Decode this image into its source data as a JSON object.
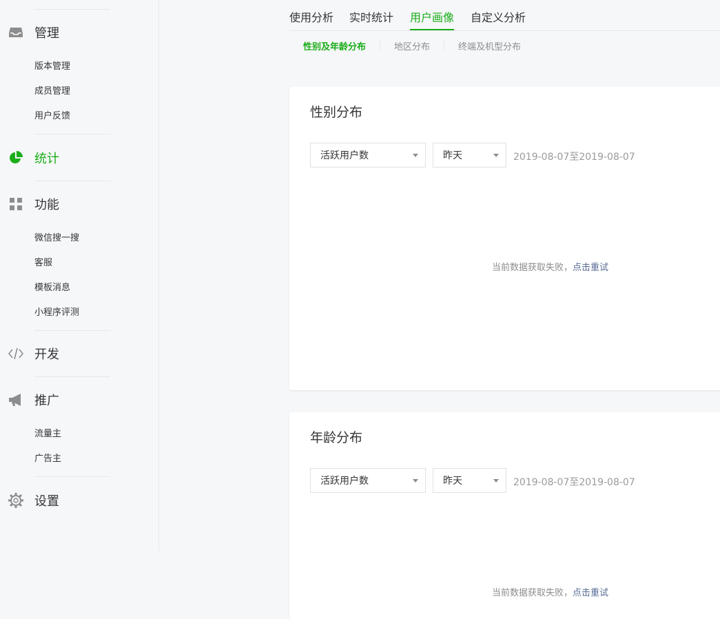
{
  "sidebar": {
    "groups": [
      {
        "label": "管理",
        "icon": "inbox-icon",
        "items": [
          "版本管理",
          "成员管理",
          "用户反馈"
        ]
      },
      {
        "label": "统计",
        "icon": "pie-chart-icon",
        "active": true,
        "items": []
      },
      {
        "label": "功能",
        "icon": "grid-icon",
        "items": [
          "微信搜一搜",
          "客服",
          "模板消息",
          "小程序评测"
        ]
      },
      {
        "label": "开发",
        "icon": "code-icon",
        "items": []
      },
      {
        "label": "推广",
        "icon": "megaphone-icon",
        "items": [
          "流量主",
          "广告主"
        ]
      },
      {
        "label": "设置",
        "icon": "gear-icon",
        "items": []
      }
    ]
  },
  "tabs": [
    "使用分析",
    "实时统计",
    "用户画像",
    "自定义分析"
  ],
  "active_tab": "用户画像",
  "subtabs": [
    "性别及年龄分布",
    "地区分布",
    "终端及机型分布"
  ],
  "active_subtab": "性别及年龄分布",
  "cards": [
    {
      "title": "性别分布",
      "metric_select": "活跃用户数",
      "period_select": "昨天",
      "date_range": "2019-08-07至2019-08-07",
      "error_text": "当前数据获取失败，",
      "retry_text": "点击重试"
    },
    {
      "title": "年龄分布",
      "metric_select": "活跃用户数",
      "period_select": "昨天",
      "date_range": "2019-08-07至2019-08-07",
      "error_text": "当前数据获取失败，",
      "retry_text": "点击重试"
    }
  ],
  "colors": {
    "accent": "#1aad19",
    "link": "#576b95",
    "icon": "#8d8d8d"
  }
}
